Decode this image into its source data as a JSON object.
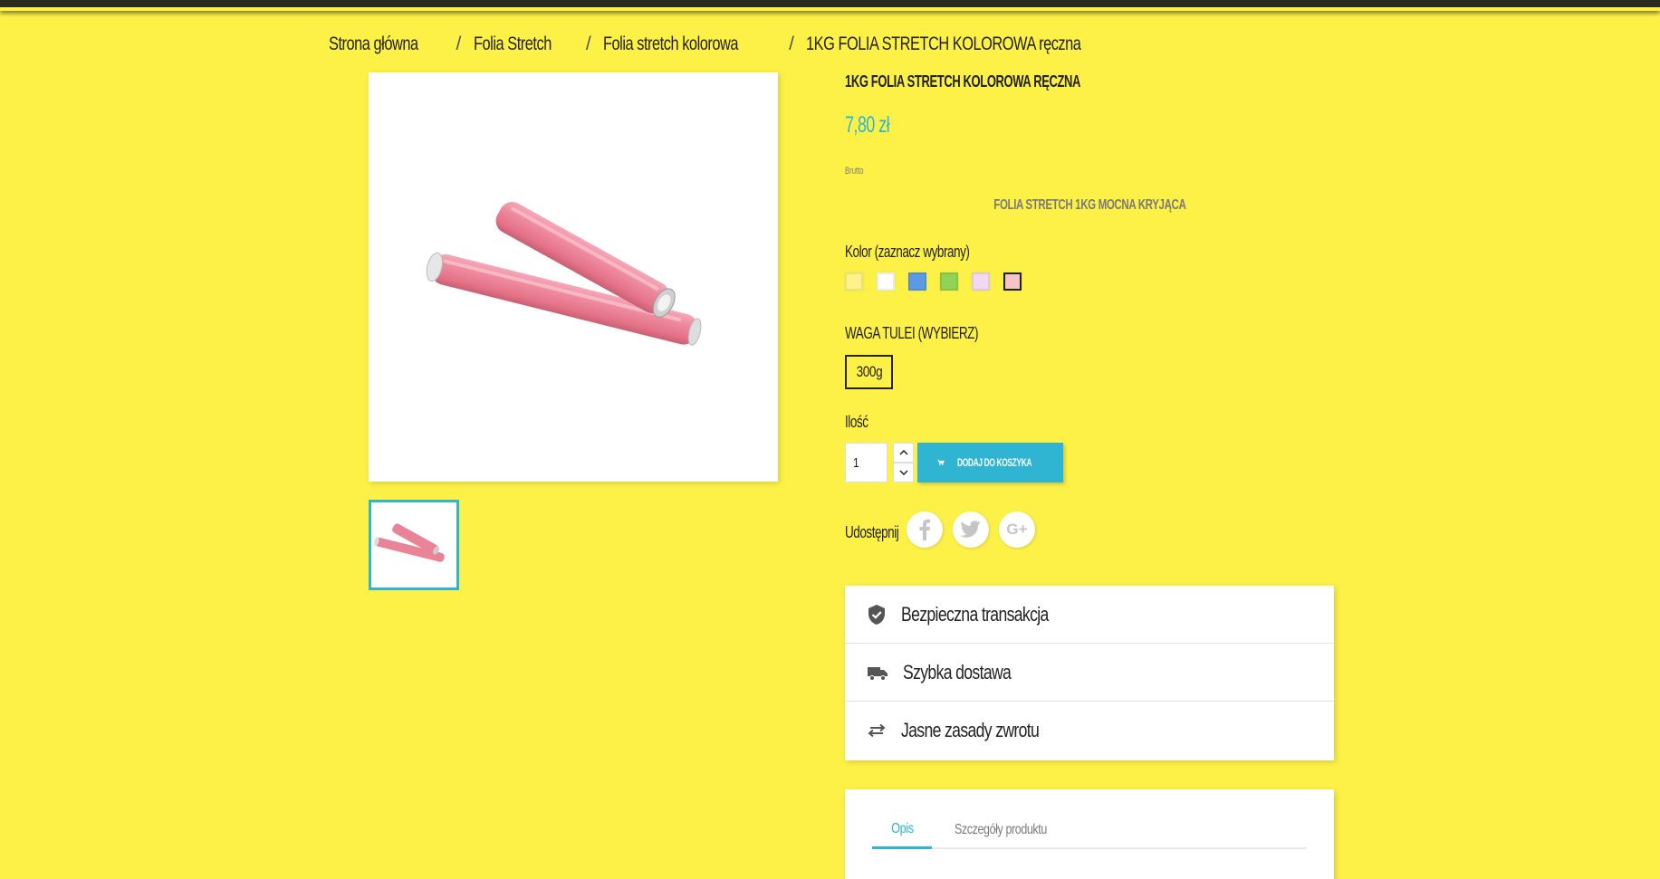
{
  "breadcrumb": {
    "items": [
      "Strona główna",
      "Folia Stretch",
      "Folia stretch kolorowa",
      "1KG FOLIA STRETCH KOLOROWA ręczna"
    ],
    "separator": "/"
  },
  "product": {
    "title": "1KG FOLIA STRETCH KOLOROWA RĘCZNA",
    "price": "7,80 zł",
    "tax_label": "Brutto",
    "short_description": "FOLIA STRETCH 1KG MOCNA KRYJĄCA",
    "image_icon": "pink-stretch-film-rolls-image"
  },
  "variants": {
    "color_label": "Kolor (zaznacz wybrany)",
    "colors": [
      "#fdf38a",
      "#ffffff",
      "#5b9be6",
      "#93d353",
      "#f2d8f0",
      "#f7c3c8"
    ],
    "selected_color_index": 5,
    "weight_label": "WAGA TULEI (WYBIERZ)",
    "weight_option": "300g"
  },
  "quantity": {
    "label": "Ilość",
    "value": "1",
    "add_to_cart": "DODAJ DO KOSZYKA"
  },
  "share": {
    "label": "Udostępnij",
    "icons": [
      "facebook-icon",
      "twitter-icon",
      "google-plus-icon"
    ],
    "google_plus_text": "G+"
  },
  "reassurance": {
    "items": [
      {
        "icon": "shield-check-icon",
        "text": "Bezpieczna transakcja"
      },
      {
        "icon": "truck-icon",
        "text": "Szybka dostawa"
      },
      {
        "icon": "swap-arrows-icon",
        "text": "Jasne zasady zwrotu"
      }
    ]
  },
  "tabs": {
    "items": [
      "Opis",
      "Szczegóły produktu"
    ],
    "active_index": 0
  },
  "colors": {
    "background": "#fdf147",
    "accent": "#2fb5d2",
    "text": "#232323",
    "muted": "#7a7a7a"
  }
}
